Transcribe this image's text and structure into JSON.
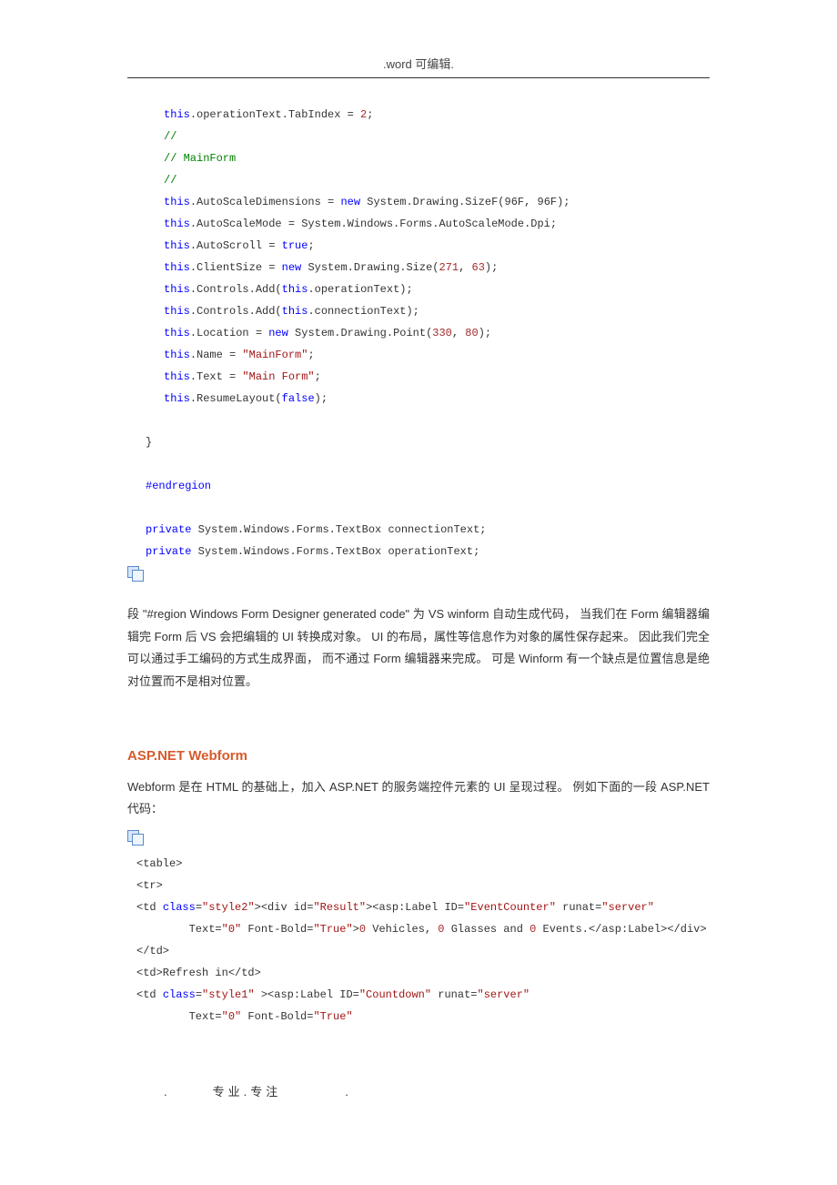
{
  "header": ".word 可编辑.",
  "code1": {
    "l1_a": "this",
    "l1_b": ".operationText.TabIndex = ",
    "l1_c": "2",
    "l1_d": ";",
    "l2": "//",
    "l3": "// MainForm",
    "l4": "//",
    "l5_a": "this",
    "l5_b": ".AutoScaleDimensions = ",
    "l5_c": "new",
    "l5_d": " System.Drawing.SizeF(96F, 96F);",
    "l6_a": "this",
    "l6_b": ".AutoScaleMode = System.Windows.Forms.AutoScaleMode.Dpi;",
    "l7_a": "this",
    "l7_b": ".AutoScroll = ",
    "l7_c": "true",
    "l7_d": ";",
    "l8_a": "this",
    "l8_b": ".ClientSize = ",
    "l8_c": "new",
    "l8_d": " System.Drawing.Size(",
    "l8_e": "271",
    "l8_f": ", ",
    "l8_g": "63",
    "l8_h": ");",
    "l9_a": "this",
    "l9_b": ".Controls.Add(",
    "l9_c": "this",
    "l9_d": ".operationText);",
    "l10_a": "this",
    "l10_b": ".Controls.Add(",
    "l10_c": "this",
    "l10_d": ".connectionText);",
    "l11_a": "this",
    "l11_b": ".Location = ",
    "l11_c": "new",
    "l11_d": " System.Drawing.Point(",
    "l11_e": "330",
    "l11_f": ", ",
    "l11_g": "80",
    "l11_h": ");",
    "l12_a": "this",
    "l12_b": ".Name = ",
    "l12_c": "\"MainForm\"",
    "l12_d": ";",
    "l13_a": "this",
    "l13_b": ".Text = ",
    "l13_c": "\"Main Form\"",
    "l13_d": ";",
    "l14_a": "this",
    "l14_b": ".ResumeLayout(",
    "l14_c": "false",
    "l14_d": ");",
    "l15": "}",
    "l16": "#endregion",
    "l17_a": "private",
    "l17_b": " System.Windows.Forms.TextBox connectionText;",
    "l18_a": "private",
    "l18_b": " System.Windows.Forms.TextBox operationText;"
  },
  "para1": "段 \"#region Windows Form Designer generated code\" 为 VS winform 自动生成代码， 当我们在 Form 编辑器编辑完 Form 后 VS 会把编辑的 UI 转换成对象。 UI 的布局，属性等信息作为对象的属性保存起来。 因此我们完全可以通过手工编码的方式生成界面， 而不通过 Form 编辑器来完成。 可是 Winform 有一个缺点是位置信息是绝对位置而不是相对位置。",
  "heading1": "ASP.NET Webform",
  "para2": "Webform 是在 HTML 的基础上，加入 ASP.NET 的服务端控件元素的 UI 呈现过程。 例如下面的一段 ASP.NET 代码：",
  "code2": {
    "r1": "<table>",
    "r2": "<tr>",
    "r3_a": "<td ",
    "r3_b": "class",
    "r3_c": "=",
    "r3_d": "\"style2\"",
    "r3_e": "><div id=",
    "r3_f": "\"Result\"",
    "r3_g": "><asp:Label ID=",
    "r3_h": "\"EventCounter\"",
    "r3_i": " runat=",
    "r3_j": "\"server\"",
    "r4_a": "        Text=",
    "r4_b": "\"0\"",
    "r4_c": " Font-Bold=",
    "r4_d": "\"True\"",
    "r4_e": ">",
    "r4_f": "0",
    "r4_g": " Vehicles, ",
    "r4_h": "0",
    "r4_i": " Glasses and ",
    "r4_j": "0",
    "r4_k": " Events.</asp:Label></div>",
    "r5": "</td>",
    "r6": "<td>Refresh in</td>",
    "r7_a": "<td ",
    "r7_b": "class",
    "r7_c": "=",
    "r7_d": "\"style1\"",
    "r7_e": " ><asp:Label ID=",
    "r7_f": "\"Countdown\"",
    "r7_g": " runat=",
    "r7_h": "\"server\"",
    "r8_a": "        Text=",
    "r8_b": "\"0\"",
    "r8_c": " Font-Bold=",
    "r8_d": "\"True\""
  },
  "footer_dot1": ".",
  "footer_text": "专业.专注",
  "footer_dot2": "."
}
